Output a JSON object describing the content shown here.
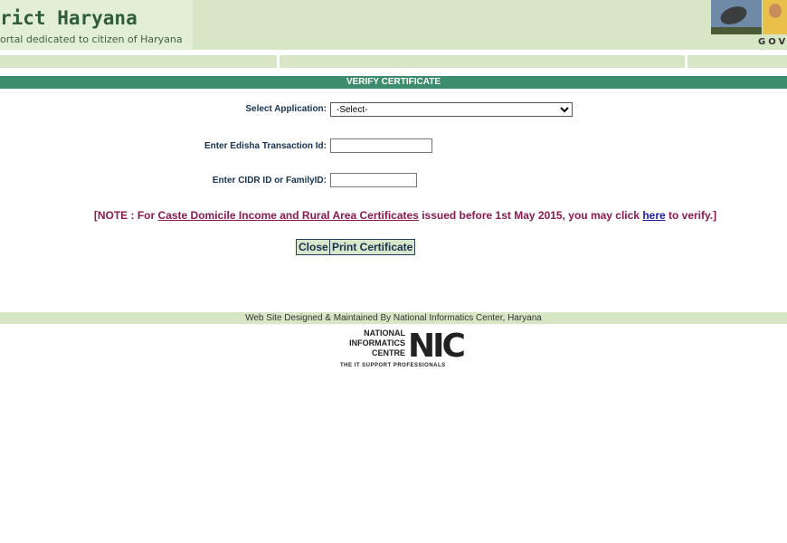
{
  "header": {
    "site_title": "rict Haryana",
    "tagline": "ortal dedicated to citizen of Haryana",
    "gov_text": "GOV"
  },
  "page": {
    "title_bar": "VERIFY CERTIFICATE"
  },
  "form": {
    "select_application_label": "Select  Application:",
    "select_application_value": "-Select-",
    "transaction_label": "Enter Edisha Transaction Id:",
    "transaction_value": "",
    "cidr_label": "Enter CIDR ID or FamilyID:",
    "cidr_value": ""
  },
  "note": {
    "prefix": "[NOTE : For ",
    "link_text": "Caste Domicile Income and Rural Area Certificates",
    "middle": " issued before 1st May 2015, you may click ",
    "here_text": "here",
    "suffix": " to verify.]"
  },
  "buttons": {
    "close": "Close",
    "print": "Print Certificate"
  },
  "footer": {
    "credit": "Web Site Designed & Maintained By National Informatics Center, Haryana",
    "logo_line1": "NATIONAL",
    "logo_line2": "INFORMATICS",
    "logo_line3": "CENTRE",
    "logo_big": "NIC",
    "logo_tag": "THE IT SUPPORT PROFESSIONALS"
  },
  "colors": {
    "banner": "#d7e6c4",
    "title_bar": "#3e8c6e",
    "note_text": "#8b1a52",
    "label_text": "#16324f"
  }
}
